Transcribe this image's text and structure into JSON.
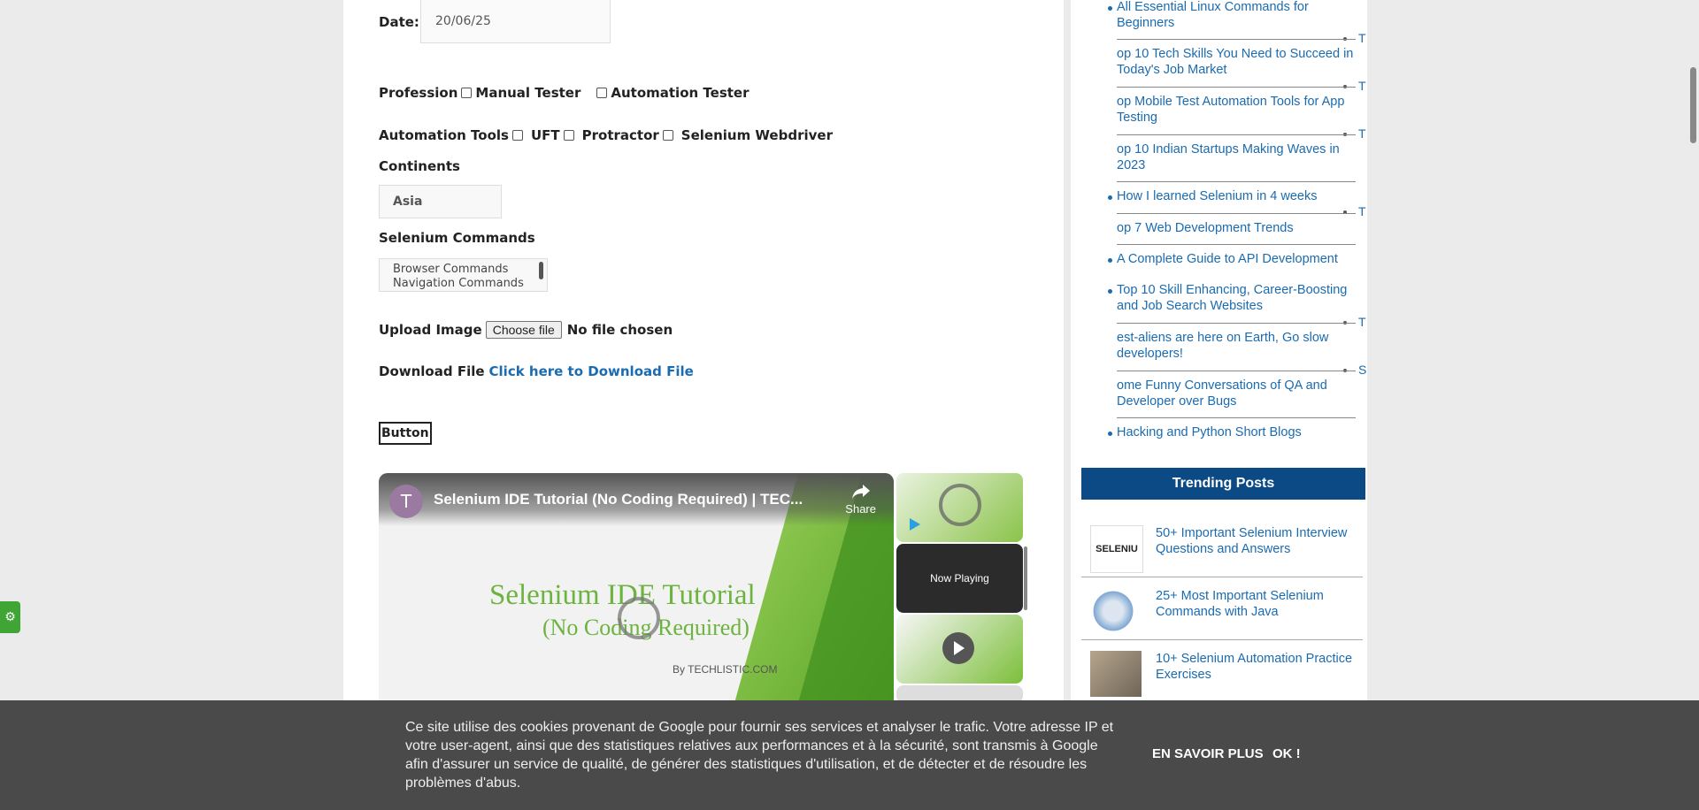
{
  "form": {
    "date_label": "Date:",
    "date_value": "20/06/25",
    "profession_label": "Profession",
    "profession_options": [
      "Manual Tester",
      "Automation Tester"
    ],
    "tools_label": "Automation Tools",
    "tools_options": [
      "UFT",
      "Protractor",
      "Selenium Webdriver"
    ],
    "continents_label": "Continents",
    "continents_selected": "Asia",
    "commands_label": "Selenium Commands",
    "commands_options": [
      "Browser Commands",
      "Navigation Commands"
    ],
    "upload_label": "Upload Image",
    "choose_file": "Choose file",
    "no_file": "No file chosen",
    "download_label": "Download File",
    "download_link": "Click here to Download File",
    "button_label": "Button"
  },
  "video": {
    "avatar": "T",
    "title": "Selenium IDE Tutorial (No Coding Required) | TEC...",
    "share": "Share",
    "slide_line1": "Selenium IDE Tutorial",
    "slide_line2": "(No Coding Required)",
    "slide_by": "By TECHLISTIC.COM",
    "now_playing": "Now Playing"
  },
  "sidebar": {
    "links": [
      {
        "text": "All Essential Linux Commands for Beginners"
      },
      {
        "text": "op 10 Tech Skills You Need to Succeed in Today's Job Market"
      },
      {
        "text": "op Mobile Test Automation Tools for App Testing"
      },
      {
        "text": "op 10 Indian Startups Making Waves in 2023"
      },
      {
        "text": "How I learned Selenium in 4 weeks"
      },
      {
        "text": "op 7 Web Development Trends"
      },
      {
        "text": "A Complete Guide to API Development"
      },
      {
        "text": "Top 10 Skill Enhancing, Career-Boosting and Job Search Websites"
      },
      {
        "text": "est-aliens are here on Earth, Go slow developers!"
      },
      {
        "text": "ome Funny Conversations of QA and Developer over Bugs"
      },
      {
        "text": "Hacking and Python Short Blogs"
      }
    ],
    "stray_letters": [
      "T",
      "T",
      "T",
      "T",
      "T",
      "S"
    ],
    "trending_title": "Trending Posts",
    "trending": [
      {
        "text": "50+ Important Selenium Interview Questions and Answers",
        "img_text": "SELENIU"
      },
      {
        "text": "25+ Most Important Selenium Commands with Java"
      },
      {
        "text": "10+ Selenium Automation Practice Exercises"
      }
    ]
  },
  "cookie": {
    "text": "Ce site utilise des cookies provenant de Google pour fournir ses services et analyser le trafic. Votre adresse IP et votre user-agent, ainsi que des statistiques relatives aux performances et à la sécurité, sont transmis à Google afin d'assurer un service de qualité, de générer des statistiques d'utilisation, et de détecter et de résoudre les problèmes d'abus.",
    "learn_more": "EN SAVOIR PLUS",
    "ok": "OK !"
  },
  "icons": {
    "settings_tab": "gear-icon",
    "share": "share-icon",
    "play": "play-icon"
  },
  "colors": {
    "link": "#1a6bb0",
    "trending_header": "#0c4a86",
    "cookie_bg": "#4a4a4a",
    "settings_tab": "#3fa535"
  }
}
